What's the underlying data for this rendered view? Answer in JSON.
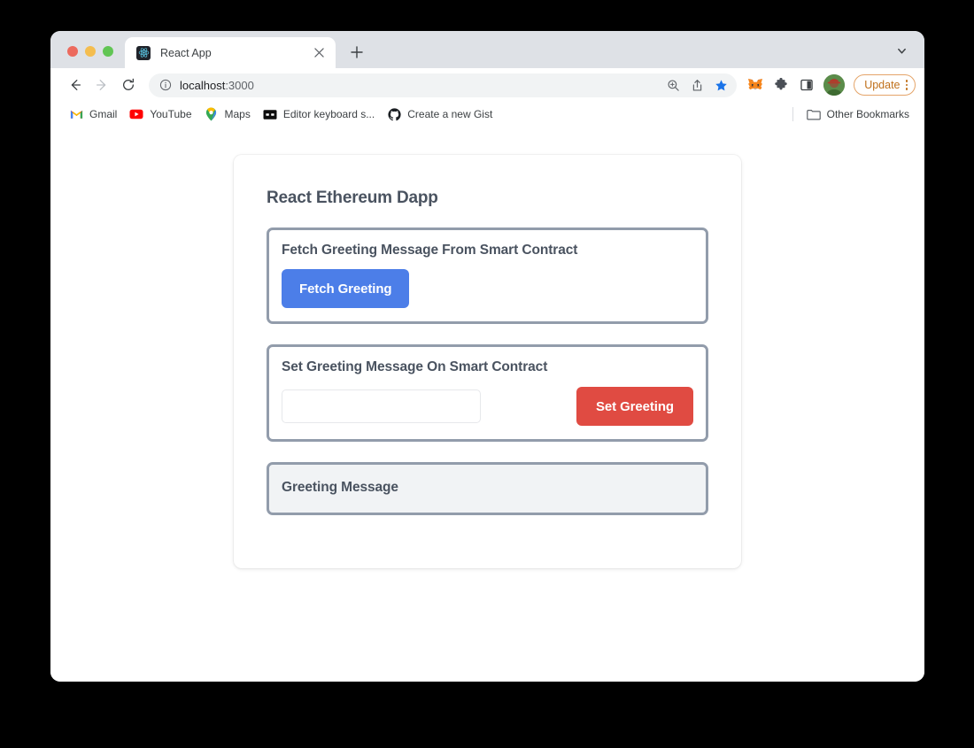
{
  "browser": {
    "tab": {
      "title": "React App",
      "favicon_icon": "react-logo-icon",
      "close_icon": "close-icon"
    },
    "new_tab_icon": "plus-icon",
    "tab_strip_chevron_icon": "chevron-down-icon",
    "nav": {
      "back_icon": "arrow-left-icon",
      "forward_icon": "arrow-right-icon",
      "reload_icon": "reload-icon"
    },
    "omnibox": {
      "info_icon": "info-circle-icon",
      "url_host": "localhost",
      "url_port": ":3000",
      "zoom_icon": "zoom-search-icon",
      "share_icon": "share-icon",
      "bookmark_star_icon": "star-icon"
    },
    "extensions": {
      "metamask_icon": "metamask-fox-icon",
      "puzzle_icon": "puzzle-piece-icon",
      "sidebar_icon": "sidebar-panel-icon",
      "avatar_icon": "profile-avatar-icon"
    },
    "update": {
      "label": "Update",
      "menu_icon": "kebab-menu-icon",
      "accent": "#c0701a"
    },
    "bookmarks": [
      {
        "label": "Gmail",
        "icon": "gmail-icon"
      },
      {
        "label": "YouTube",
        "icon": "youtube-icon"
      },
      {
        "label": "Maps",
        "icon": "google-maps-pin-icon"
      },
      {
        "label": "Editor keyboard s...",
        "icon": "editor-keyboard-icon"
      },
      {
        "label": "Create a new Gist",
        "icon": "github-octocat-icon"
      }
    ],
    "other_bookmarks": {
      "label": "Other Bookmarks",
      "icon": "folder-icon"
    }
  },
  "app": {
    "title": "React Ethereum Dapp",
    "cards": [
      {
        "title": "Fetch Greeting Message From Smart Contract",
        "button_label": "Fetch Greeting",
        "button_color": "#4c7ee8"
      },
      {
        "title": "Set Greeting Message On Smart Contract",
        "input_value": "",
        "input_placeholder": "",
        "button_label": "Set Greeting",
        "button_color": "#e04b42"
      },
      {
        "title": "Greeting Message",
        "message": ""
      }
    ]
  }
}
